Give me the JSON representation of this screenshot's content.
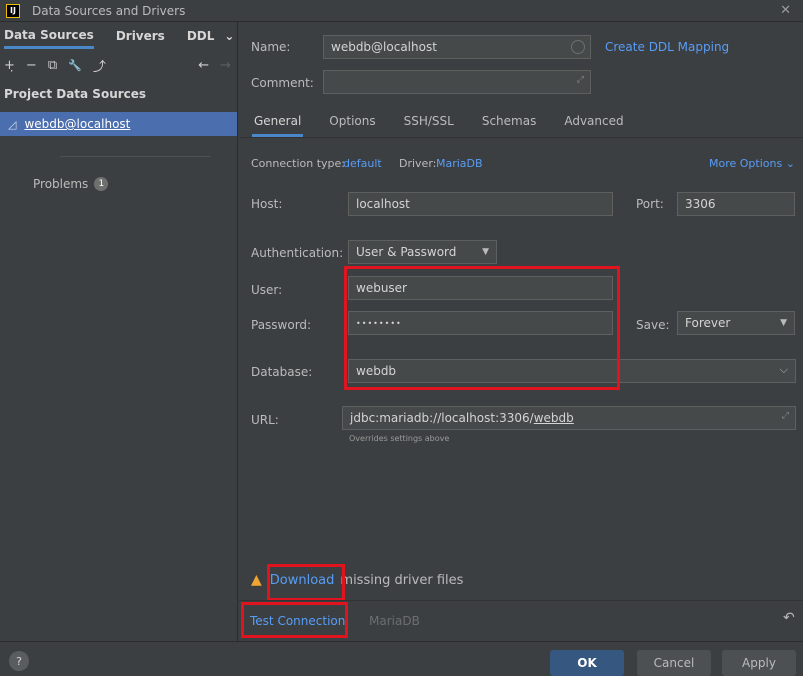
{
  "window": {
    "app_icon_text": "IJ",
    "title": "Data Sources and Drivers",
    "close_glyph": "✕"
  },
  "left": {
    "tabs": [
      "Data Sources",
      "Drivers",
      "DDL"
    ],
    "tabs_chevron": "⌄",
    "toolbar": {
      "add": "+̣",
      "remove": "−",
      "duplicate": "⧉",
      "wrench": "🔧",
      "export": "⤴",
      "back": "←",
      "forward": "→"
    },
    "section_title": "Project Data Sources",
    "items": [
      {
        "label": "webdb@localhost",
        "icon": "datasource-icon"
      }
    ],
    "problems_label": "Problems",
    "problems_count": "1"
  },
  "form": {
    "name_label": "Name:",
    "name_value": "webdb@localhost",
    "create_ddl_link": "Create DDL Mapping",
    "comment_label": "Comment:",
    "comment_value": "",
    "tabs": [
      "General",
      "Options",
      "SSH/SSL",
      "Schemas",
      "Advanced"
    ],
    "connection_type_label": "Connection type:",
    "connection_type_value": "default",
    "driver_label": "Driver:",
    "driver_value": "MariaDB",
    "more_options": "More Options ⌄",
    "host_label": "Host:",
    "host_value": "localhost",
    "port_label": "Port:",
    "port_value": "3306",
    "auth_label": "Authentication:",
    "auth_value": "User & Password",
    "user_label": "User:",
    "user_value": "webuser",
    "password_label": "Password:",
    "password_value": "••••••••",
    "save_label": "Save:",
    "save_value": "Forever",
    "database_label": "Database:",
    "database_value": "webdb",
    "url_label": "URL:",
    "url_prefix": "jdbc:mariadb://localhost:3306/",
    "url_db": "webdb",
    "url_note": "Overrides settings above",
    "warning_link": "Download",
    "warning_text": "missing driver files",
    "test_connection": "Test Connection",
    "test_driver": "MariaDB",
    "revert_glyph": "↶"
  },
  "footer": {
    "help": "?",
    "ok": "OK",
    "cancel": "Cancel",
    "apply": "Apply"
  }
}
